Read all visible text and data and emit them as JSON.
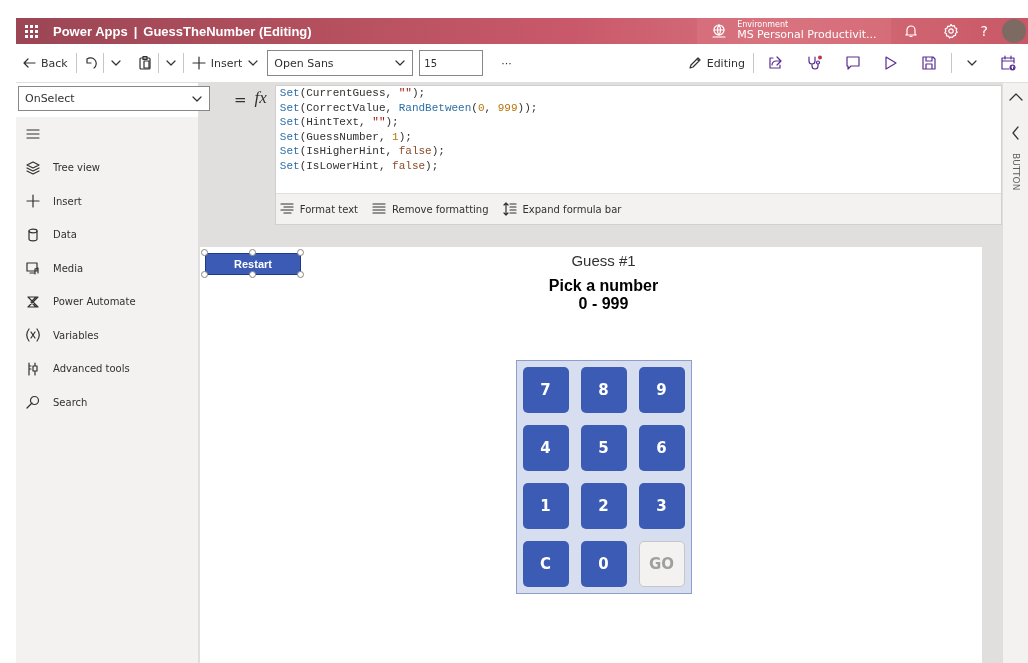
{
  "header": {
    "app_name": "Power Apps",
    "separator": "|",
    "title": "GuessTheNumber (Editing)",
    "environment_label": "Environment",
    "environment_name": "MS Personal Productivit...",
    "help": "?"
  },
  "toolbar": {
    "back": "Back",
    "insert": "Insert",
    "font": "Open Sans",
    "font_size": "15",
    "more": "···",
    "mode": "Editing"
  },
  "formula_bar": {
    "property": "OnSelect",
    "equals": "=",
    "fx": "fx",
    "lines": [
      [
        {
          "kind": "fn",
          "text": "Set"
        },
        {
          "kind": "plain",
          "text": "(CurrentGuess, "
        },
        {
          "kind": "str",
          "text": "\"\""
        },
        {
          "kind": "plain",
          "text": ");"
        }
      ],
      [
        {
          "kind": "fn",
          "text": "Set"
        },
        {
          "kind": "plain",
          "text": "(CorrectValue, "
        },
        {
          "kind": "fn",
          "text": "RandBetween"
        },
        {
          "kind": "plain",
          "text": "("
        },
        {
          "kind": "num",
          "text": "0"
        },
        {
          "kind": "plain",
          "text": ", "
        },
        {
          "kind": "num",
          "text": "999"
        },
        {
          "kind": "plain",
          "text": "));"
        }
      ],
      [
        {
          "kind": "fn",
          "text": "Set"
        },
        {
          "kind": "plain",
          "text": "(HintText, "
        },
        {
          "kind": "str",
          "text": "\"\""
        },
        {
          "kind": "plain",
          "text": ");"
        }
      ],
      [
        {
          "kind": "fn",
          "text": "Set"
        },
        {
          "kind": "plain",
          "text": "(GuessNumber, "
        },
        {
          "kind": "num",
          "text": "1"
        },
        {
          "kind": "plain",
          "text": ");"
        }
      ],
      [
        {
          "kind": "fn",
          "text": "Set"
        },
        {
          "kind": "plain",
          "text": "(IsHigherHint, "
        },
        {
          "kind": "bool",
          "text": "false"
        },
        {
          "kind": "plain",
          "text": ");"
        }
      ],
      [
        {
          "kind": "fn",
          "text": "Set"
        },
        {
          "kind": "plain",
          "text": "(IsLowerHint, "
        },
        {
          "kind": "bool",
          "text": "false"
        },
        {
          "kind": "plain",
          "text": ");"
        }
      ]
    ],
    "actions": [
      {
        "label": "Format text"
      },
      {
        "label": "Remove formatting"
      },
      {
        "label": "Expand formula bar"
      }
    ]
  },
  "sidebar": {
    "items": [
      {
        "label": "Tree view"
      },
      {
        "label": "Insert"
      },
      {
        "label": "Data"
      },
      {
        "label": "Media"
      },
      {
        "label": "Power Automate"
      },
      {
        "label": "Variables"
      },
      {
        "label": "Advanced tools"
      },
      {
        "label": "Search"
      }
    ]
  },
  "right_panel": {
    "label": "BUTTON"
  },
  "screen": {
    "restart_button": "Restart",
    "title": "Guess #1",
    "prompt": "Pick a number",
    "range": "0 - 999",
    "keys": [
      {
        "label": "7",
        "disabled": false
      },
      {
        "label": "8",
        "disabled": false
      },
      {
        "label": "9",
        "disabled": false
      },
      {
        "label": "4",
        "disabled": false
      },
      {
        "label": "5",
        "disabled": false
      },
      {
        "label": "6",
        "disabled": false
      },
      {
        "label": "1",
        "disabled": false
      },
      {
        "label": "2",
        "disabled": false
      },
      {
        "label": "3",
        "disabled": false
      },
      {
        "label": "C",
        "disabled": false
      },
      {
        "label": "0",
        "disabled": false
      },
      {
        "label": "GO",
        "disabled": true
      }
    ]
  }
}
